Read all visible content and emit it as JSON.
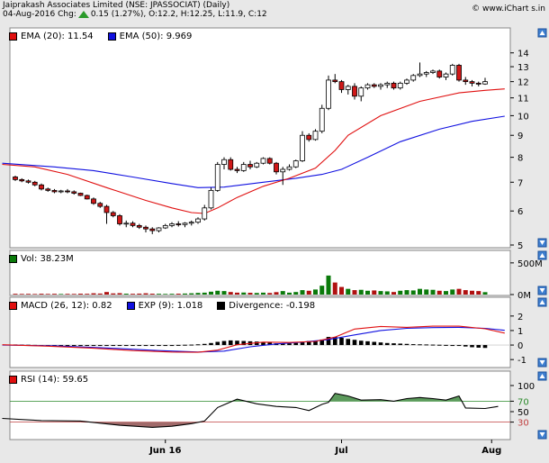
{
  "header": {
    "title": "Jaiprakash Associates Limited (NSE: JPASSOCIAT) (Daily)",
    "quote_prefix": "04-Aug-2016 Chg:",
    "quote_rest": "0.15 (1.27%), O:12.2, H:12.25, L:11.9, C:12",
    "brand": "© www.iChart s.in",
    "up_color": "#2a9a2a"
  },
  "panels": {
    "price": {
      "legend": [
        {
          "label": "EMA (20): 11.54",
          "color": "#e01010"
        },
        {
          "label": "EMA (50): 9.969",
          "color": "#1010e0"
        }
      ]
    },
    "volume": {
      "legend": [
        {
          "label": "Vol: 38.23M",
          "color": "#0a7a0a"
        }
      ]
    },
    "macd": {
      "legend": [
        {
          "label": "MACD (26, 12): 0.82",
          "color": "#e01010"
        },
        {
          "label": "EXP (9): 1.018",
          "color": "#1010e0"
        },
        {
          "label": "Divergence: -0.198",
          "color": "#000000"
        }
      ]
    },
    "rsi": {
      "legend": [
        {
          "label": "RSI (14): 59.65",
          "color": "#e01010"
        }
      ]
    }
  },
  "chart_data": {
    "type": "candlestick",
    "title": "Jaiprakash Associates Limited (NSE: JPASSOCIAT) (Daily)",
    "x_labels": [
      {
        "i": 23,
        "label": "Jun 16"
      },
      {
        "i": 50,
        "label": "Jul"
      },
      {
        "i": 73,
        "label": "Aug"
      }
    ],
    "price_axis": {
      "ticks": [
        5,
        6,
        7,
        8,
        9,
        10,
        11,
        12,
        13,
        14
      ],
      "scale": "log",
      "ylim": [
        5,
        14.6
      ]
    },
    "volume_axis": {
      "ticks": [
        "0M",
        "500M"
      ],
      "ylim": [
        0,
        640
      ]
    },
    "macd_axis": {
      "ticks": [
        -1,
        0,
        1,
        2
      ],
      "ylim": [
        -1.3,
        2.3
      ]
    },
    "rsi_axis": {
      "ticks": [
        30,
        50,
        70,
        100
      ],
      "ylim": [
        0,
        100
      ],
      "bands": [
        30,
        70
      ]
    },
    "ohlc": [
      [
        7.2,
        7.25,
        7.05,
        7.1
      ],
      [
        7.1,
        7.15,
        7.0,
        7.05
      ],
      [
        7.05,
        7.1,
        6.95,
        7.0
      ],
      [
        7.0,
        7.05,
        6.85,
        6.9
      ],
      [
        6.9,
        6.95,
        6.7,
        6.75
      ],
      [
        6.75,
        6.8,
        6.65,
        6.7
      ],
      [
        6.7,
        6.75,
        6.6,
        6.65
      ],
      [
        6.65,
        6.72,
        6.6,
        6.68
      ],
      [
        6.68,
        6.75,
        6.6,
        6.65
      ],
      [
        6.65,
        6.7,
        6.55,
        6.6
      ],
      [
        6.6,
        6.62,
        6.5,
        6.52
      ],
      [
        6.52,
        6.55,
        6.38,
        6.4
      ],
      [
        6.4,
        6.45,
        6.2,
        6.25
      ],
      [
        6.25,
        6.3,
        6.1,
        6.15
      ],
      [
        6.15,
        6.2,
        5.6,
        5.95
      ],
      [
        5.95,
        6.0,
        5.8,
        5.85
      ],
      [
        5.85,
        5.9,
        5.55,
        5.6
      ],
      [
        5.6,
        5.7,
        5.5,
        5.62
      ],
      [
        5.62,
        5.68,
        5.5,
        5.55
      ],
      [
        5.55,
        5.6,
        5.45,
        5.5
      ],
      [
        5.5,
        5.55,
        5.35,
        5.45
      ],
      [
        5.45,
        5.5,
        5.3,
        5.4
      ],
      [
        5.4,
        5.5,
        5.35,
        5.48
      ],
      [
        5.48,
        5.6,
        5.45,
        5.55
      ],
      [
        5.55,
        5.65,
        5.5,
        5.6
      ],
      [
        5.6,
        5.68,
        5.52,
        5.58
      ],
      [
        5.58,
        5.65,
        5.5,
        5.62
      ],
      [
        5.62,
        5.7,
        5.55,
        5.65
      ],
      [
        5.65,
        5.8,
        5.6,
        5.75
      ],
      [
        5.75,
        6.2,
        5.7,
        6.1
      ],
      [
        6.1,
        6.8,
        6.05,
        6.7
      ],
      [
        6.7,
        7.8,
        6.65,
        7.7
      ],
      [
        7.7,
        8.0,
        7.5,
        7.9
      ],
      [
        7.9,
        8.0,
        7.45,
        7.5
      ],
      [
        7.5,
        7.6,
        7.35,
        7.45
      ],
      [
        7.45,
        7.8,
        7.4,
        7.7
      ],
      [
        7.7,
        7.85,
        7.5,
        7.6
      ],
      [
        7.6,
        7.8,
        7.55,
        7.75
      ],
      [
        7.75,
        8.0,
        7.7,
        7.95
      ],
      [
        7.95,
        8.0,
        7.7,
        7.75
      ],
      [
        7.75,
        7.8,
        7.3,
        7.4
      ],
      [
        7.4,
        7.6,
        6.9,
        7.5
      ],
      [
        7.5,
        7.7,
        7.45,
        7.6
      ],
      [
        7.6,
        7.9,
        7.55,
        7.85
      ],
      [
        7.85,
        9.2,
        7.8,
        9.0
      ],
      [
        9.0,
        9.1,
        8.7,
        8.8
      ],
      [
        8.8,
        9.3,
        8.75,
        9.2
      ],
      [
        9.2,
        10.6,
        9.1,
        10.4
      ],
      [
        10.4,
        12.4,
        10.3,
        12.1
      ],
      [
        12.1,
        12.5,
        11.9,
        12.0
      ],
      [
        12.0,
        12.1,
        11.3,
        11.5
      ],
      [
        11.5,
        11.8,
        11.2,
        11.7
      ],
      [
        11.7,
        11.9,
        10.9,
        11.1
      ],
      [
        11.1,
        11.7,
        10.8,
        11.6
      ],
      [
        11.6,
        11.9,
        11.5,
        11.8
      ],
      [
        11.8,
        11.9,
        11.6,
        11.7
      ],
      [
        11.7,
        11.9,
        11.5,
        11.8
      ],
      [
        11.8,
        12.0,
        11.6,
        11.9
      ],
      [
        11.9,
        12.0,
        11.5,
        11.6
      ],
      [
        11.6,
        12.0,
        11.5,
        11.9
      ],
      [
        11.9,
        12.2,
        11.8,
        12.1
      ],
      [
        12.1,
        12.5,
        12.0,
        12.4
      ],
      [
        12.4,
        13.3,
        12.3,
        12.5
      ],
      [
        12.5,
        12.7,
        12.3,
        12.6
      ],
      [
        12.6,
        12.8,
        12.5,
        12.7
      ],
      [
        12.7,
        12.8,
        12.2,
        12.3
      ],
      [
        12.3,
        12.6,
        12.1,
        12.5
      ],
      [
        12.5,
        13.2,
        12.4,
        13.1
      ],
      [
        13.1,
        13.2,
        12.0,
        12.1
      ],
      [
        12.1,
        12.3,
        11.8,
        12.0
      ],
      [
        12.0,
        12.1,
        11.7,
        11.9
      ],
      [
        11.9,
        12.0,
        11.7,
        11.85
      ],
      [
        11.85,
        12.25,
        11.8,
        12.0
      ]
    ],
    "ema20": [
      [
        -2,
        7.7
      ],
      [
        3,
        7.6
      ],
      [
        8,
        7.3
      ],
      [
        14,
        6.8
      ],
      [
        20,
        6.35
      ],
      [
        24,
        6.1
      ],
      [
        27,
        5.95
      ],
      [
        29,
        5.92
      ],
      [
        31,
        6.1
      ],
      [
        34,
        6.45
      ],
      [
        38,
        6.85
      ],
      [
        42,
        7.15
      ],
      [
        46,
        7.55
      ],
      [
        49,
        8.3
      ],
      [
        51,
        9.0
      ],
      [
        56,
        10.0
      ],
      [
        62,
        10.8
      ],
      [
        68,
        11.3
      ],
      [
        72,
        11.45
      ],
      [
        75,
        11.54
      ]
    ],
    "ema50": [
      [
        -2,
        7.75
      ],
      [
        6,
        7.6
      ],
      [
        12,
        7.45
      ],
      [
        18,
        7.2
      ],
      [
        24,
        6.95
      ],
      [
        28,
        6.8
      ],
      [
        32,
        6.82
      ],
      [
        38,
        7.0
      ],
      [
        43,
        7.15
      ],
      [
        47,
        7.3
      ],
      [
        50,
        7.5
      ],
      [
        54,
        8.0
      ],
      [
        59,
        8.7
      ],
      [
        65,
        9.3
      ],
      [
        70,
        9.7
      ],
      [
        75,
        9.97
      ]
    ],
    "volume": [
      12,
      10,
      11,
      9,
      13,
      10,
      12,
      9,
      11,
      10,
      14,
      12,
      20,
      16,
      40,
      18,
      22,
      14,
      12,
      15,
      20,
      14,
      12,
      10,
      12,
      14,
      16,
      20,
      26,
      30,
      45,
      60,
      55,
      40,
      30,
      32,
      28,
      25,
      30,
      25,
      38,
      55,
      30,
      40,
      70,
      60,
      80,
      140,
      300,
      190,
      120,
      90,
      70,
      75,
      60,
      65,
      55,
      50,
      40,
      60,
      70,
      65,
      90,
      80,
      75,
      60,
      55,
      80,
      90,
      70,
      60,
      55,
      38
    ],
    "macd": [
      [
        -2,
        0.02
      ],
      [
        5,
        -0.08
      ],
      [
        12,
        -0.22
      ],
      [
        18,
        -0.38
      ],
      [
        24,
        -0.48
      ],
      [
        28,
        -0.5
      ],
      [
        31,
        -0.35
      ],
      [
        34,
        0.02
      ],
      [
        38,
        0.2
      ],
      [
        42,
        0.18
      ],
      [
        46,
        0.25
      ],
      [
        49,
        0.55
      ],
      [
        52,
        1.1
      ],
      [
        56,
        1.28
      ],
      [
        60,
        1.22
      ],
      [
        64,
        1.3
      ],
      [
        68,
        1.3
      ],
      [
        72,
        1.12
      ],
      [
        75,
        0.82
      ]
    ],
    "macd_signal": [
      [
        -2,
        0.0
      ],
      [
        6,
        -0.05
      ],
      [
        14,
        -0.2
      ],
      [
        22,
        -0.38
      ],
      [
        28,
        -0.48
      ],
      [
        32,
        -0.42
      ],
      [
        36,
        -0.12
      ],
      [
        40,
        0.08
      ],
      [
        44,
        0.2
      ],
      [
        48,
        0.38
      ],
      [
        52,
        0.7
      ],
      [
        56,
        1.0
      ],
      [
        60,
        1.15
      ],
      [
        64,
        1.2
      ],
      [
        68,
        1.22
      ],
      [
        72,
        1.15
      ],
      [
        75,
        1.018
      ]
    ],
    "divergence": [
      0.04,
      0.03,
      0.02,
      0.01,
      0,
      -0.02,
      -0.03,
      -0.03,
      -0.04,
      -0.04,
      -0.05,
      -0.05,
      -0.05,
      -0.06,
      -0.06,
      -0.05,
      -0.05,
      -0.04,
      -0.04,
      -0.03,
      -0.03,
      -0.02,
      -0.02,
      -0.01,
      0,
      0.01,
      0.02,
      0.03,
      0.05,
      0.08,
      0.14,
      0.22,
      0.28,
      0.32,
      0.3,
      0.28,
      0.26,
      0.24,
      0.2,
      0.16,
      0.12,
      0.1,
      0.12,
      0.15,
      0.2,
      0.28,
      0.3,
      0.38,
      0.56,
      0.56,
      0.5,
      0.42,
      0.36,
      0.3,
      0.26,
      0.22,
      0.18,
      0.14,
      0.12,
      0.1,
      0.08,
      0.06,
      0.05,
      0.04,
      0.03,
      0.02,
      0.01,
      0.0,
      -0.05,
      -0.1,
      -0.15,
      -0.18,
      -0.198
    ],
    "rsi": [
      [
        -2,
        37
      ],
      [
        4,
        33
      ],
      [
        10,
        32
      ],
      [
        16,
        24
      ],
      [
        21,
        20
      ],
      [
        24,
        22
      ],
      [
        27,
        27
      ],
      [
        29,
        32
      ],
      [
        31,
        58
      ],
      [
        34,
        74
      ],
      [
        37,
        65
      ],
      [
        40,
        60
      ],
      [
        43,
        58
      ],
      [
        45,
        52
      ],
      [
        47,
        64
      ],
      [
        48,
        68
      ],
      [
        49,
        85
      ],
      [
        51,
        80
      ],
      [
        53,
        72
      ],
      [
        56,
        73
      ],
      [
        58,
        70
      ],
      [
        60,
        75
      ],
      [
        62,
        77
      ],
      [
        64,
        75
      ],
      [
        66,
        72
      ],
      [
        68,
        80
      ],
      [
        69,
        57
      ],
      [
        72,
        56
      ],
      [
        74,
        60
      ]
    ]
  }
}
